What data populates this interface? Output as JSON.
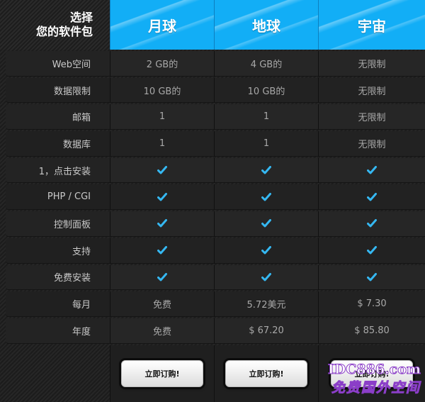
{
  "header": {
    "title_line1": "选择",
    "title_line2": "您的软件包",
    "plans": [
      "月球",
      "地球",
      "宇宙"
    ]
  },
  "rows": [
    {
      "label": "Web空间",
      "values": [
        "2 GB的",
        "4 GB的",
        "无限制"
      ]
    },
    {
      "label": "数据限制",
      "values": [
        "10 GB的",
        "10 GB的",
        "无限制"
      ]
    },
    {
      "label": "邮箱",
      "values": [
        "1",
        "1",
        "无限制"
      ]
    },
    {
      "label": "数据库",
      "values": [
        "1",
        "1",
        "无限制"
      ]
    },
    {
      "label": "1，点击安装",
      "values": [
        "check",
        "check",
        "check"
      ]
    },
    {
      "label": "PHP / CGI",
      "values": [
        "check",
        "check",
        "check"
      ]
    },
    {
      "label": "控制面板",
      "values": [
        "check",
        "check",
        "check"
      ]
    },
    {
      "label": "支持",
      "values": [
        "check",
        "check",
        "check"
      ]
    },
    {
      "label": "免费安装",
      "values": [
        "check",
        "check",
        "check"
      ]
    },
    {
      "label": "每月",
      "values": [
        "免费",
        "5.72美元",
        "$ 7.30"
      ]
    },
    {
      "label": "年度",
      "values": [
        "免费",
        "$ 67.20",
        "$ 85.80"
      ]
    }
  ],
  "buttons": [
    "立即订购!",
    "立即订购!",
    "立即订购!"
  ],
  "watermark": {
    "line1": "IDC886.com",
    "line2": "免费国外空间"
  },
  "colors": {
    "accent": "#12aef6",
    "check": "#35b8f2",
    "background": "#1e1e1e"
  }
}
